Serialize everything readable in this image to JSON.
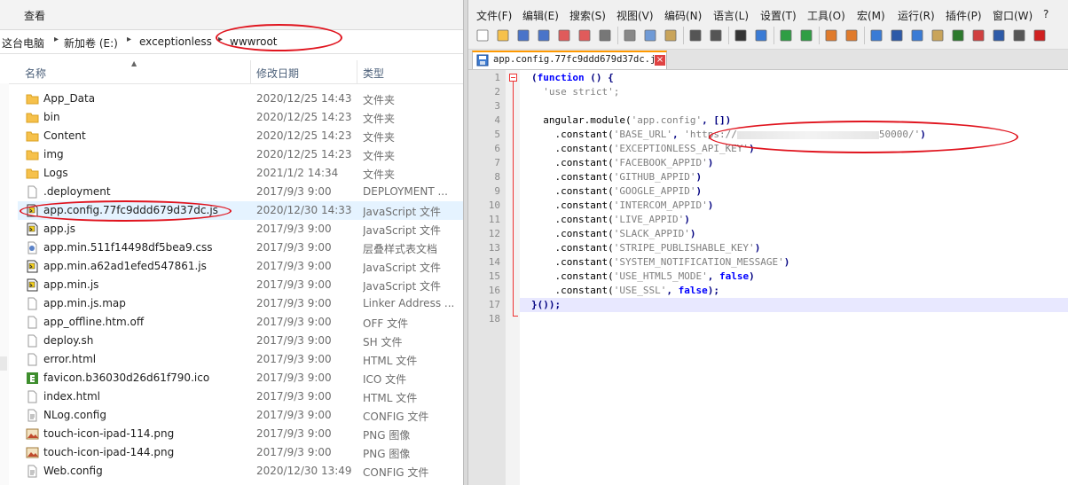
{
  "explorer": {
    "menu_view": "查看",
    "breadcrumbs": [
      "这台电脑",
      "新加卷 (E:)",
      "exceptionless",
      "wwwroot"
    ],
    "columns": {
      "name": "名称",
      "date": "修改日期",
      "type": "类型"
    },
    "files": [
      {
        "name": "App_Data",
        "date": "2020/12/25 14:43",
        "type": "文件夹",
        "icon": "folder-icon"
      },
      {
        "name": "bin",
        "date": "2020/12/25 14:23",
        "type": "文件夹",
        "icon": "folder-icon"
      },
      {
        "name": "Content",
        "date": "2020/12/25 14:23",
        "type": "文件夹",
        "icon": "folder-icon"
      },
      {
        "name": "img",
        "date": "2020/12/25 14:23",
        "type": "文件夹",
        "icon": "folder-icon"
      },
      {
        "name": "Logs",
        "date": "2021/1/2 14:34",
        "type": "文件夹",
        "icon": "folder-icon"
      },
      {
        "name": ".deployment",
        "date": "2017/9/3 9:00",
        "type": "DEPLOYMENT ...",
        "icon": "file-icon"
      },
      {
        "name": "app.config.77fc9ddd679d37dc.js",
        "date": "2020/12/30 14:33",
        "type": "JavaScript 文件",
        "icon": "js-file-icon"
      },
      {
        "name": "app.js",
        "date": "2017/9/3 9:00",
        "type": "JavaScript 文件",
        "icon": "js-file-icon"
      },
      {
        "name": "app.min.511f14498df5bea9.css",
        "date": "2017/9/3 9:00",
        "type": "层叠样式表文档",
        "icon": "css-file-icon"
      },
      {
        "name": "app.min.a62ad1efed547861.js",
        "date": "2017/9/3 9:00",
        "type": "JavaScript 文件",
        "icon": "js-file-icon"
      },
      {
        "name": "app.min.js",
        "date": "2017/9/3 9:00",
        "type": "JavaScript 文件",
        "icon": "js-file-icon"
      },
      {
        "name": "app.min.js.map",
        "date": "2017/9/3 9:00",
        "type": "Linker Address ...",
        "icon": "file-icon"
      },
      {
        "name": "app_offline.htm.off",
        "date": "2017/9/3 9:00",
        "type": "OFF 文件",
        "icon": "file-icon"
      },
      {
        "name": "deploy.sh",
        "date": "2017/9/3 9:00",
        "type": "SH 文件",
        "icon": "file-icon"
      },
      {
        "name": "error.html",
        "date": "2017/9/3 9:00",
        "type": "HTML 文件",
        "icon": "file-icon"
      },
      {
        "name": "favicon.b36030d26d61f790.ico",
        "date": "2017/9/3 9:00",
        "type": "ICO 文件",
        "icon": "ico-file-icon"
      },
      {
        "name": "index.html",
        "date": "2017/9/3 9:00",
        "type": "HTML 文件",
        "icon": "file-icon"
      },
      {
        "name": "NLog.config",
        "date": "2017/9/3 9:00",
        "type": "CONFIG 文件",
        "icon": "config-file-icon"
      },
      {
        "name": "touch-icon-ipad-114.png",
        "date": "2017/9/3 9:00",
        "type": "PNG 图像",
        "icon": "image-file-icon"
      },
      {
        "name": "touch-icon-ipad-144.png",
        "date": "2017/9/3 9:00",
        "type": "PNG 图像",
        "icon": "image-file-icon"
      },
      {
        "name": "Web.config",
        "date": "2020/12/30 13:49",
        "type": "CONFIG 文件",
        "icon": "config-file-icon"
      }
    ]
  },
  "notepad": {
    "menus": [
      "文件(F)",
      "编辑(E)",
      "搜索(S)",
      "视图(V)",
      "编码(N)",
      "语言(L)",
      "设置(T)",
      "工具(O)",
      "宏(M)",
      "运行(R)",
      "插件(P)",
      "窗口(W)",
      "?"
    ],
    "tab_label": "app.config.77fc9ddd679d37dc.js",
    "tab_close": "×",
    "line_numbers": [
      "1",
      "2",
      "3",
      "4",
      "5",
      "6",
      "7",
      "8",
      "9",
      "10",
      "11",
      "12",
      "13",
      "14",
      "15",
      "16",
      "17",
      "18"
    ],
    "code": {
      "l1": {
        "kw": "function",
        "rest": " () {"
      },
      "l2": "'use strict';",
      "l4": {
        "id": "angular.module(",
        "str": "'app.config'",
        "rest": ", [])"
      },
      "l5": {
        "pre": ".constant(",
        "key": "'BASE_URL'",
        "mid": ", ",
        "url_start": "'https://",
        "url_end": "50000/'",
        "post": ")"
      },
      "l6": {
        "pre": ".constant(",
        "key": "'EXCEPTIONLESS_API_KEY'",
        "post": ")"
      },
      "l7": {
        "pre": ".constant(",
        "key": "'FACEBOOK_APPID'",
        "post": ")"
      },
      "l8": {
        "pre": ".constant(",
        "key": "'GITHUB_APPID'",
        "post": ")"
      },
      "l9": {
        "pre": ".constant(",
        "key": "'GOOGLE_APPID'",
        "post": ")"
      },
      "l10": {
        "pre": ".constant(",
        "key": "'INTERCOM_APPID'",
        "post": ")"
      },
      "l11": {
        "pre": ".constant(",
        "key": "'LIVE_APPID'",
        "post": ")"
      },
      "l12": {
        "pre": ".constant(",
        "key": "'SLACK_APPID'",
        "post": ")"
      },
      "l13": {
        "pre": ".constant(",
        "key": "'STRIPE_PUBLISHABLE_KEY'",
        "post": ")"
      },
      "l14": {
        "pre": ".constant(",
        "key": "'SYSTEM_NOTIFICATION_MESSAGE'",
        "post": ")"
      },
      "l15": {
        "pre": ".constant(",
        "key": "'USE_HTML5_MODE'",
        "mid": ", ",
        "kw": "false",
        "post": ")"
      },
      "l16": {
        "pre": ".constant(",
        "key": "'USE_SSL'",
        "mid": ", ",
        "kw": "false",
        "post": ");"
      },
      "l17": "}());"
    }
  },
  "colors": {
    "annotation": "#e0141e",
    "keyword": "#0000ff",
    "string": "#808080",
    "selection": "#e5f3ff"
  }
}
